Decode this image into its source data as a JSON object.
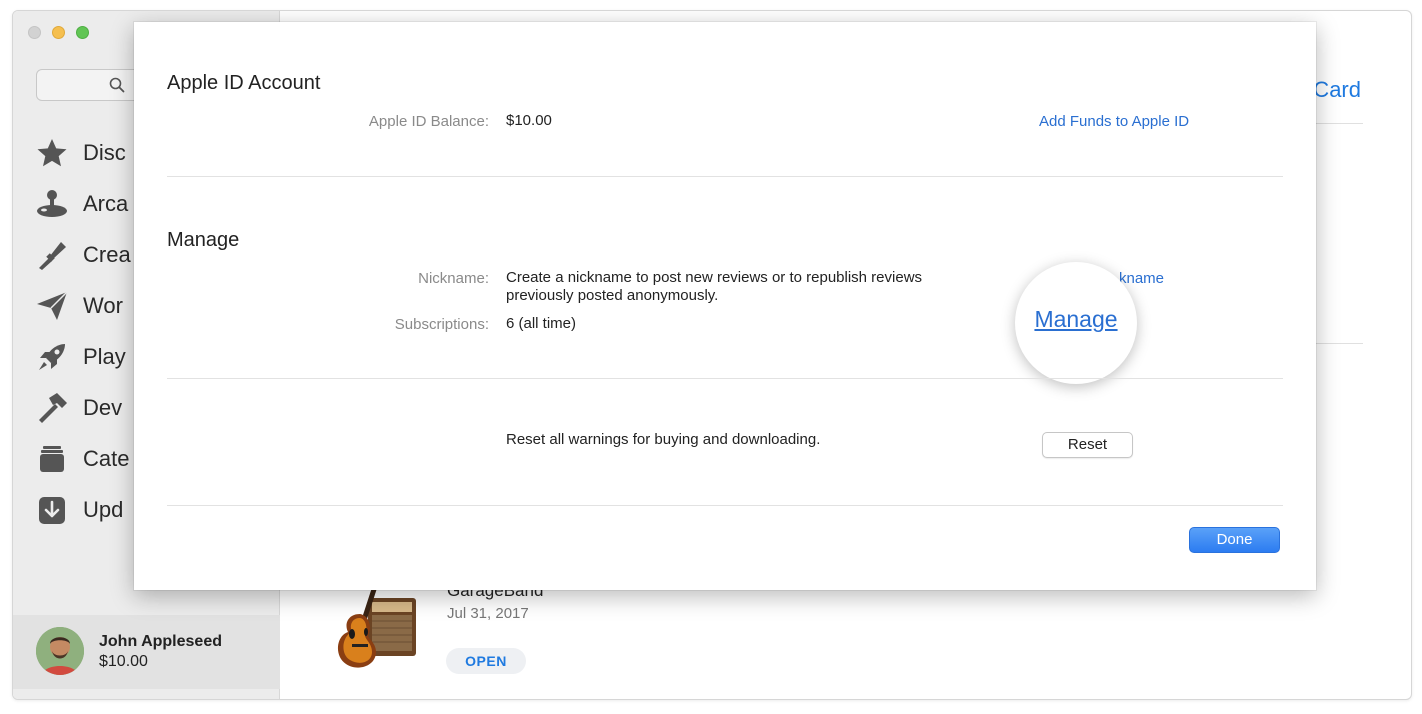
{
  "sidebar": {
    "items": [
      {
        "label": "Disc",
        "icon": "star-icon"
      },
      {
        "label": "Arca",
        "icon": "joystick-icon"
      },
      {
        "label": "Crea",
        "icon": "brush-icon"
      },
      {
        "label": "Wor",
        "icon": "paper-plane-icon"
      },
      {
        "label": "Play",
        "icon": "rocket-icon"
      },
      {
        "label": "Dev",
        "icon": "hammer-icon"
      },
      {
        "label": "Cate",
        "icon": "stack-icon"
      },
      {
        "label": "Upd",
        "icon": "download-icon"
      }
    ],
    "user": {
      "name": "John Appleseed",
      "balance": "$10.00"
    }
  },
  "main": {
    "gift_card_partial": "t Card",
    "app": {
      "name": "GarageBand",
      "date": "Jul 31, 2017",
      "open_label": "OPEN"
    }
  },
  "sheet": {
    "apple_id": {
      "title": "Apple ID Account",
      "balance_label": "Apple ID Balance:",
      "balance_value": "$10.00",
      "add_funds_link": "Add Funds to Apple ID"
    },
    "manage": {
      "title": "Manage",
      "nickname_label": "Nickname:",
      "nickname_value_line1": "Create a nickname to post new reviews or to republish reviews",
      "nickname_value_line2": "previously posted anonymously.",
      "nickname_link_partial": "kname",
      "subscriptions_label": "Subscriptions:",
      "subscriptions_value": "6 (all time)",
      "manage_link": "Manage"
    },
    "reset": {
      "text": "Reset all warnings for buying and downloading.",
      "button_label": "Reset"
    },
    "done_label": "Done"
  },
  "colors": {
    "accent": "#2a6fd1",
    "done_button": "#2c7cf1",
    "traffic_min": "#f5bf4f",
    "traffic_max": "#61c554"
  }
}
